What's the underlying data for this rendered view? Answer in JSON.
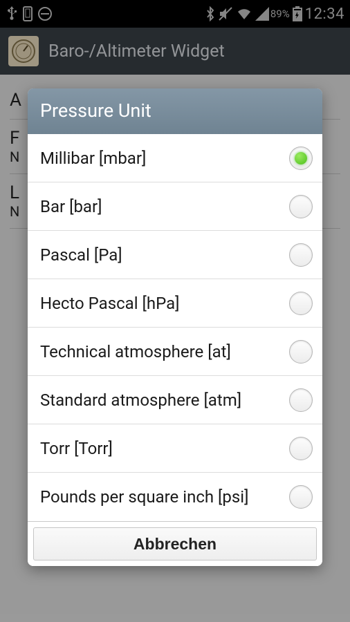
{
  "status": {
    "battery_pct": "89%",
    "time": "12:34"
  },
  "actionbar": {
    "title": "Baro-/Altimeter Widget"
  },
  "background": {
    "rows": [
      {
        "title": "A"
      },
      {
        "title": "F",
        "sub": "N"
      },
      {
        "title": "L",
        "sub": "N"
      }
    ]
  },
  "dialog": {
    "title": "Pressure Unit",
    "options": [
      {
        "label": "Millibar [mbar]",
        "selected": true
      },
      {
        "label": "Bar [bar]",
        "selected": false
      },
      {
        "label": "Pascal [Pa]",
        "selected": false
      },
      {
        "label": "Hecto Pascal [hPa]",
        "selected": false
      },
      {
        "label": "Technical atmosphere [at]",
        "selected": false
      },
      {
        "label": "Standard atmosphere [atm]",
        "selected": false
      },
      {
        "label": "Torr [Torr]",
        "selected": false
      },
      {
        "label": "Pounds per square inch [psi]",
        "selected": false
      }
    ],
    "cancel": "Abbrechen"
  }
}
